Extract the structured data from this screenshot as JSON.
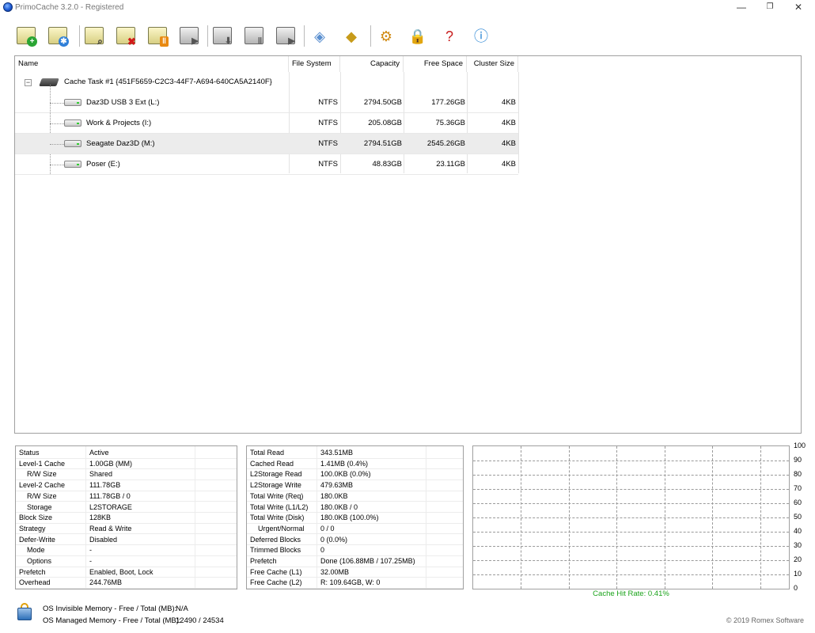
{
  "window": {
    "title": "PrimoCache 3.2.0 - Registered",
    "minimize": "—",
    "maximize": "❐",
    "close": "✕"
  },
  "toolbar": {
    "buttons": [
      {
        "name": "new-cache-task-button",
        "icon": "add-icon"
      },
      {
        "name": "cache-options-button",
        "icon": "settings-icon"
      },
      {
        "name": "cache-statistics-button",
        "icon": "search-icon"
      },
      {
        "name": "delete-cache-task-button",
        "icon": "delete-icon"
      },
      {
        "name": "pause-cache-button",
        "icon": "pause-icon"
      },
      {
        "name": "resume-cache-button",
        "icon": "play-icon"
      },
      {
        "name": "flush-button",
        "icon": "download-icon"
      },
      {
        "name": "pause-flush-button",
        "icon": "pause-icon"
      },
      {
        "name": "resume-flush-button",
        "icon": "play-icon"
      },
      {
        "name": "manage-storage-button",
        "icon": "storage-icon"
      },
      {
        "name": "l2-storage-button",
        "icon": "key-icon"
      },
      {
        "name": "settings-button",
        "icon": "gear-icon"
      },
      {
        "name": "license-button",
        "icon": "lock-icon"
      },
      {
        "name": "help-button",
        "icon": "help-icon"
      },
      {
        "name": "about-button",
        "icon": "info-icon"
      }
    ]
  },
  "tree": {
    "columns": [
      "Name",
      "File System",
      "Capacity",
      "Free Space",
      "Cluster Size"
    ],
    "task": {
      "label": "Cache Task #1 {451F5659-C2C3-44F7-A694-640CA5A2140F}",
      "expander": "−"
    },
    "volumes": [
      {
        "name": "Daz3D USB 3 Ext (L:)",
        "fs": "NTFS",
        "capacity": "2794.50GB",
        "free": "177.26GB",
        "cluster": "4KB"
      },
      {
        "name": "Work & Projects (I:)",
        "fs": "NTFS",
        "capacity": "205.08GB",
        "free": "75.36GB",
        "cluster": "4KB"
      },
      {
        "name": "Seagate Daz3D (M:)",
        "fs": "NTFS",
        "capacity": "2794.51GB",
        "free": "2545.26GB",
        "cluster": "4KB",
        "selected": true
      },
      {
        "name": "Poser (E:)",
        "fs": "NTFS",
        "capacity": "48.83GB",
        "free": "23.11GB",
        "cluster": "4KB"
      }
    ]
  },
  "config_panel": {
    "rows": [
      {
        "k": "Status",
        "v": "Active",
        "indent": false
      },
      {
        "k": "Level-1 Cache",
        "v": "1.00GB (MM)",
        "indent": false
      },
      {
        "k": "R/W Size",
        "v": "Shared",
        "indent": true
      },
      {
        "k": "Level-2 Cache",
        "v": "111.78GB",
        "indent": false
      },
      {
        "k": "R/W Size",
        "v": "111.78GB / 0",
        "indent": true
      },
      {
        "k": "Storage",
        "v": "L2STORAGE",
        "indent": true
      },
      {
        "k": "Block Size",
        "v": "128KB",
        "indent": false
      },
      {
        "k": "Strategy",
        "v": "Read & Write",
        "indent": false
      },
      {
        "k": "Defer-Write",
        "v": "Disabled",
        "indent": false
      },
      {
        "k": "Mode",
        "v": "-",
        "indent": true
      },
      {
        "k": "Options",
        "v": "-",
        "indent": true
      },
      {
        "k": "Prefetch",
        "v": "Enabled, Boot, Lock",
        "indent": false
      },
      {
        "k": "Overhead",
        "v": "244.76MB",
        "indent": false
      }
    ]
  },
  "stats_panel": {
    "rows": [
      {
        "k": "Total Read",
        "v": "343.51MB",
        "indent": false
      },
      {
        "k": "Cached Read",
        "v": "1.41MB (0.4%)",
        "indent": false
      },
      {
        "k": "L2Storage Read",
        "v": "100.0KB (0.0%)",
        "indent": false
      },
      {
        "k": "L2Storage Write",
        "v": "479.63MB",
        "indent": false
      },
      {
        "k": "Total Write (Req)",
        "v": "180.0KB",
        "indent": false
      },
      {
        "k": "Total Write (L1/L2)",
        "v": "180.0KB / 0",
        "indent": false
      },
      {
        "k": "Total Write (Disk)",
        "v": "180.0KB (100.0%)",
        "indent": false
      },
      {
        "k": "Urgent/Normal",
        "v": "0 / 0",
        "indent": true
      },
      {
        "k": "Deferred Blocks",
        "v": "0 (0.0%)",
        "indent": false
      },
      {
        "k": "Trimmed Blocks",
        "v": "0",
        "indent": false
      },
      {
        "k": "Prefetch",
        "v": "Done (106.88MB / 107.25MB)",
        "indent": false
      },
      {
        "k": "Free Cache (L1)",
        "v": "32.00MB",
        "indent": false
      },
      {
        "k": "Free Cache (L2)",
        "v": "R: 109.64GB, W: 0",
        "indent": false
      }
    ]
  },
  "graph": {
    "y_ticks": [
      "100",
      "90",
      "80",
      "70",
      "60",
      "50",
      "40",
      "30",
      "20",
      "10",
      "0"
    ],
    "hit_rate_label": "Cache Hit Rate: 0.41%",
    "hit_rate_color": "#1aa31a"
  },
  "footer": {
    "invisible_label": "OS Invisible Memory - Free / Total (MB):",
    "invisible_value": "N/A",
    "managed_label": "OS Managed Memory - Free / Total (MB):",
    "managed_value": "12490 / 24534",
    "copyright": "© 2019 Romex Software"
  }
}
